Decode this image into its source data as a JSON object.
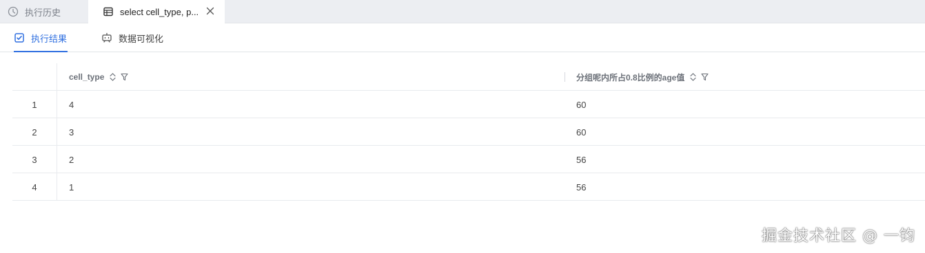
{
  "top_tabs": [
    {
      "label": "执行历史",
      "icon": "clock-icon"
    },
    {
      "label": "select cell_type, p...",
      "icon": "table-icon"
    }
  ],
  "sub_tabs": [
    {
      "label": "执行结果",
      "icon": "checkbox-icon",
      "active": true
    },
    {
      "label": "数据可视化",
      "icon": "chart-robot-icon",
      "active": false
    }
  ],
  "table": {
    "columns": [
      "cell_type",
      "分组呢内所占0.8比例的age值"
    ],
    "rows": [
      {
        "index": "1",
        "cells": [
          "4",
          "60"
        ]
      },
      {
        "index": "2",
        "cells": [
          "3",
          "60"
        ]
      },
      {
        "index": "3",
        "cells": [
          "2",
          "56"
        ]
      },
      {
        "index": "4",
        "cells": [
          "1",
          "56"
        ]
      }
    ]
  },
  "watermark": "掘金技术社区 @ 一钧",
  "colors": {
    "accent": "#2f6fe0",
    "tabbar": "#eceef2"
  }
}
